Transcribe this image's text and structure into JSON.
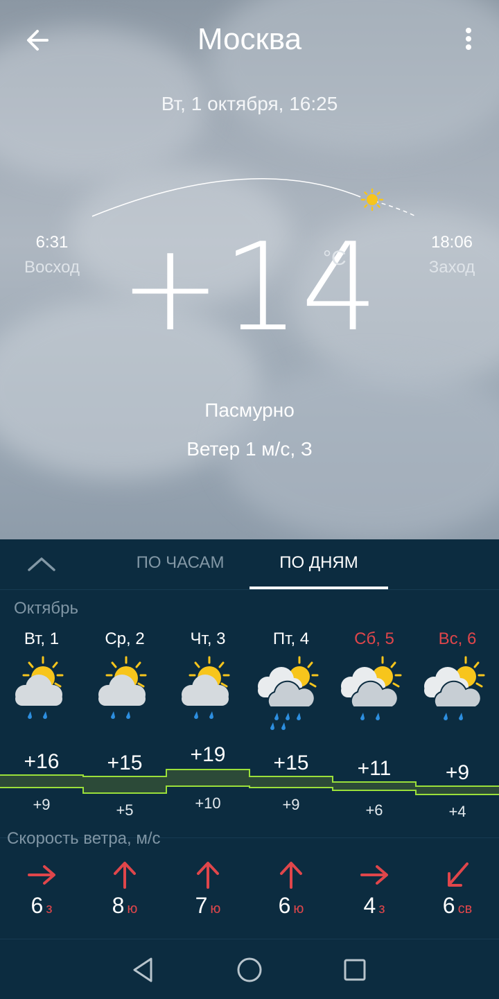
{
  "header": {
    "city": "Москва",
    "datetime": "Вт, 1 октября, 16:25"
  },
  "sun": {
    "sunrise_time": "6:31",
    "sunrise_label": "Восход",
    "sunset_time": "18:06",
    "sunset_label": "Заход"
  },
  "current": {
    "temperature": "+14",
    "unit": "°C",
    "condition": "Пасмурно",
    "wind": "Ветер 1 м/с, З"
  },
  "tabs": {
    "hours": "ПО ЧАСАМ",
    "days": "ПО ДНЯМ",
    "active": "days"
  },
  "forecast": {
    "month": "Октябрь",
    "days": [
      {
        "label": "Вт, 1",
        "weekend": false,
        "max": "+16",
        "min": "+9",
        "icon": "partly-cloudy-rain-icon"
      },
      {
        "label": "Ср, 2",
        "weekend": false,
        "max": "+15",
        "min": "+5",
        "icon": "partly-cloudy-rain-icon"
      },
      {
        "label": "Чт, 3",
        "weekend": false,
        "max": "+19",
        "min": "+10",
        "icon": "partly-cloudy-rain-icon"
      },
      {
        "label": "Пт, 4",
        "weekend": false,
        "max": "+15",
        "min": "+9",
        "icon": "cloudy-heavy-rain-icon"
      },
      {
        "label": "Сб, 5",
        "weekend": true,
        "max": "+11",
        "min": "+6",
        "icon": "cloudy-rain-icon"
      },
      {
        "label": "Вс, 6",
        "weekend": true,
        "max": "+9",
        "min": "+4",
        "icon": "cloudy-rain-icon"
      }
    ]
  },
  "wind_section": {
    "title": "Скорость ветра, м/с",
    "days": [
      {
        "speed": "6",
        "dir": "з",
        "arrow": "arrow-right-icon"
      },
      {
        "speed": "8",
        "dir": "ю",
        "arrow": "arrow-up-icon"
      },
      {
        "speed": "7",
        "dir": "ю",
        "arrow": "arrow-up-icon"
      },
      {
        "speed": "6",
        "dir": "ю",
        "arrow": "arrow-up-icon"
      },
      {
        "speed": "4",
        "dir": "з",
        "arrow": "arrow-right-icon"
      },
      {
        "speed": "6",
        "dir": "св",
        "arrow": "arrow-down-left-icon"
      }
    ]
  },
  "colors": {
    "panel_bg": "#0c2c40",
    "accent_red": "#e0464b",
    "band_green": "#9be03a",
    "sun_yellow": "#f7c51c"
  }
}
